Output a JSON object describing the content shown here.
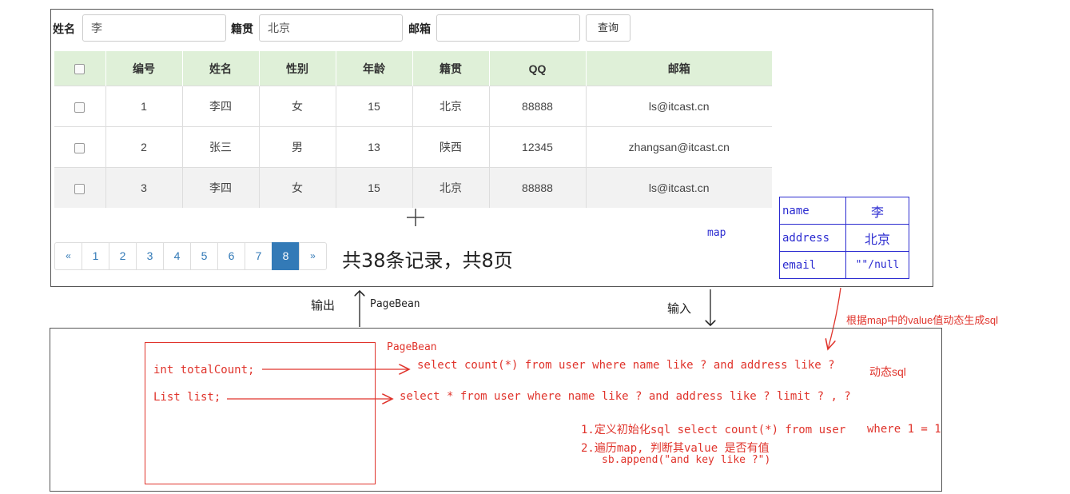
{
  "search": {
    "name_label": "姓名",
    "name_value": "李",
    "address_label": "籍贯",
    "address_value": "北京",
    "email_label": "邮箱",
    "email_value": "",
    "query_button": "查询"
  },
  "table": {
    "headers": [
      "编号",
      "姓名",
      "性别",
      "年龄",
      "籍贯",
      "QQ",
      "邮箱"
    ],
    "rows": [
      [
        "1",
        "李四",
        "女",
        "15",
        "北京",
        "88888",
        "ls@itcast.cn"
      ],
      [
        "2",
        "张三",
        "男",
        "13",
        "陕西",
        "12345",
        "zhangsan@itcast.cn"
      ],
      [
        "3",
        "李四",
        "女",
        "15",
        "北京",
        "88888",
        "ls@itcast.cn"
      ]
    ]
  },
  "pagination": {
    "prev": "«",
    "pages": [
      "1",
      "2",
      "3",
      "4",
      "5",
      "6",
      "7",
      "8"
    ],
    "active_page": "8",
    "next": "»",
    "summary": "共38条记录，共8页"
  },
  "map_note": {
    "label": "map",
    "entries": [
      {
        "key": "name",
        "value": "李"
      },
      {
        "key": "address",
        "value": "北京"
      },
      {
        "key": "email",
        "value": "\"\"/null"
      }
    ],
    "caption": "根据map中的value值动态生成sql"
  },
  "flow": {
    "output_label": "输出",
    "output_type": "PageBean",
    "input_label": "输入"
  },
  "lower": {
    "pagebean_title": "PageBean",
    "field_total": "int totalCount;",
    "field_list": "List list;",
    "sql_count": "select count(*) from user where name like ? and address like ?",
    "sql_list": "select * from user where name like ? and address like ? limit ? , ?",
    "dynamic_sql": "动态sql",
    "step1": "1.定义初始化sql select count(*) from user",
    "step1_tail": "where 1 = 1",
    "step2": "2.遍历map, 判断其value 是否有值",
    "step2_code": "sb.append(\"and  key like ?\")"
  },
  "colors": {
    "header_bg": "#dff0d8",
    "pagination_active": "#337ab7",
    "annotation_red": "#e0342c",
    "annotation_blue": "#2b2bd0"
  }
}
